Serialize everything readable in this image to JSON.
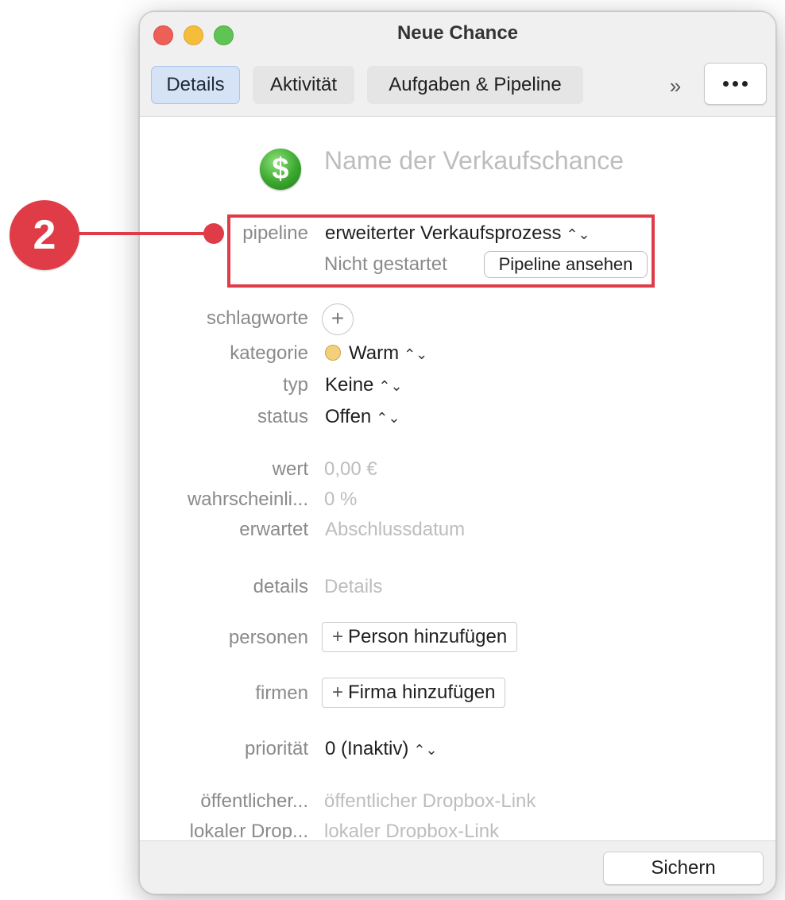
{
  "window": {
    "title": "Neue Chance"
  },
  "tabs": [
    {
      "label": "Details",
      "active": true
    },
    {
      "label": "Aktivität",
      "active": false
    },
    {
      "label": "Aufgaben & Pipeline",
      "active": false
    }
  ],
  "toolbar": {
    "more_label": "»"
  },
  "form": {
    "name_placeholder": "Name der Verkaufschance",
    "icon_symbol": "$",
    "pipeline": {
      "label": "pipeline",
      "value": "erweiterter Verkaufsprozess",
      "status": "Nicht gestartet",
      "view_button": "Pipeline ansehen"
    },
    "tags": {
      "label": "schlagworte"
    },
    "category": {
      "label": "kategorie",
      "value": "Warm",
      "color": "#f4d07a"
    },
    "type": {
      "label": "typ",
      "value": "Keine"
    },
    "status": {
      "label": "status",
      "value": "Offen"
    },
    "value": {
      "label": "wert",
      "placeholder": "0,00 €"
    },
    "probability": {
      "label": "wahrscheinli...",
      "placeholder": "0 %"
    },
    "expected": {
      "label": "erwartet",
      "placeholder": "Abschlussdatum"
    },
    "details": {
      "label": "details",
      "placeholder": "Details"
    },
    "persons": {
      "label": "personen",
      "button": "Person hinzufügen"
    },
    "companies": {
      "label": "firmen",
      "button": "Firma hinzufügen"
    },
    "priority": {
      "label": "priorität",
      "value": "0 (Inaktiv)"
    },
    "public_link": {
      "label": "öffentlicher...",
      "placeholder": "öffentlicher Dropbox-Link"
    },
    "local_link": {
      "label": "lokaler Drop...",
      "placeholder": "lokaler Dropbox-Link"
    }
  },
  "footer": {
    "save_label": "Sichern"
  },
  "annotation": {
    "number": "2",
    "color": "#e03c47"
  },
  "icons": {
    "chevron": "⌃⌄",
    "plus": "+"
  }
}
